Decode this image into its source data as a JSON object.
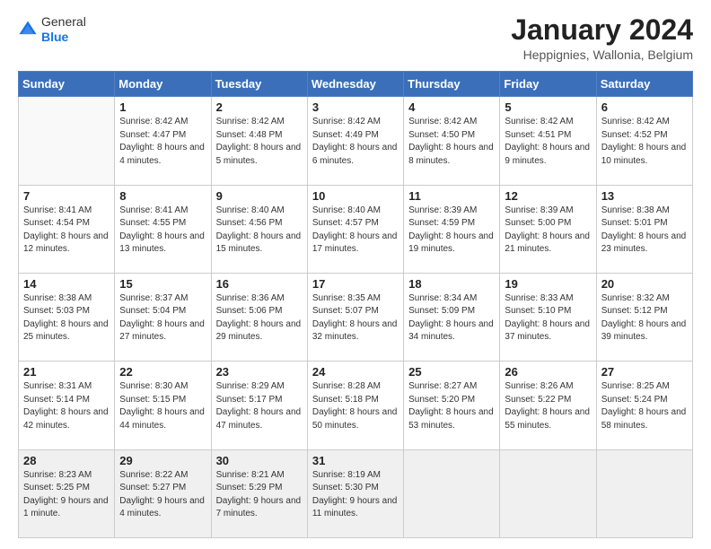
{
  "header": {
    "logo": {
      "line1": "General",
      "line2": "Blue"
    },
    "title": "January 2024",
    "subtitle": "Heppignies, Wallonia, Belgium"
  },
  "days_of_week": [
    "Sunday",
    "Monday",
    "Tuesday",
    "Wednesday",
    "Thursday",
    "Friday",
    "Saturday"
  ],
  "weeks": [
    [
      {
        "day": "",
        "sunrise": "",
        "sunset": "",
        "daylight": ""
      },
      {
        "day": "1",
        "sunrise": "Sunrise: 8:42 AM",
        "sunset": "Sunset: 4:47 PM",
        "daylight": "Daylight: 8 hours and 4 minutes."
      },
      {
        "day": "2",
        "sunrise": "Sunrise: 8:42 AM",
        "sunset": "Sunset: 4:48 PM",
        "daylight": "Daylight: 8 hours and 5 minutes."
      },
      {
        "day": "3",
        "sunrise": "Sunrise: 8:42 AM",
        "sunset": "Sunset: 4:49 PM",
        "daylight": "Daylight: 8 hours and 6 minutes."
      },
      {
        "day": "4",
        "sunrise": "Sunrise: 8:42 AM",
        "sunset": "Sunset: 4:50 PM",
        "daylight": "Daylight: 8 hours and 8 minutes."
      },
      {
        "day": "5",
        "sunrise": "Sunrise: 8:42 AM",
        "sunset": "Sunset: 4:51 PM",
        "daylight": "Daylight: 8 hours and 9 minutes."
      },
      {
        "day": "6",
        "sunrise": "Sunrise: 8:42 AM",
        "sunset": "Sunset: 4:52 PM",
        "daylight": "Daylight: 8 hours and 10 minutes."
      }
    ],
    [
      {
        "day": "7",
        "sunrise": "Sunrise: 8:41 AM",
        "sunset": "Sunset: 4:54 PM",
        "daylight": "Daylight: 8 hours and 12 minutes."
      },
      {
        "day": "8",
        "sunrise": "Sunrise: 8:41 AM",
        "sunset": "Sunset: 4:55 PM",
        "daylight": "Daylight: 8 hours and 13 minutes."
      },
      {
        "day": "9",
        "sunrise": "Sunrise: 8:40 AM",
        "sunset": "Sunset: 4:56 PM",
        "daylight": "Daylight: 8 hours and 15 minutes."
      },
      {
        "day": "10",
        "sunrise": "Sunrise: 8:40 AM",
        "sunset": "Sunset: 4:57 PM",
        "daylight": "Daylight: 8 hours and 17 minutes."
      },
      {
        "day": "11",
        "sunrise": "Sunrise: 8:39 AM",
        "sunset": "Sunset: 4:59 PM",
        "daylight": "Daylight: 8 hours and 19 minutes."
      },
      {
        "day": "12",
        "sunrise": "Sunrise: 8:39 AM",
        "sunset": "Sunset: 5:00 PM",
        "daylight": "Daylight: 8 hours and 21 minutes."
      },
      {
        "day": "13",
        "sunrise": "Sunrise: 8:38 AM",
        "sunset": "Sunset: 5:01 PM",
        "daylight": "Daylight: 8 hours and 23 minutes."
      }
    ],
    [
      {
        "day": "14",
        "sunrise": "Sunrise: 8:38 AM",
        "sunset": "Sunset: 5:03 PM",
        "daylight": "Daylight: 8 hours and 25 minutes."
      },
      {
        "day": "15",
        "sunrise": "Sunrise: 8:37 AM",
        "sunset": "Sunset: 5:04 PM",
        "daylight": "Daylight: 8 hours and 27 minutes."
      },
      {
        "day": "16",
        "sunrise": "Sunrise: 8:36 AM",
        "sunset": "Sunset: 5:06 PM",
        "daylight": "Daylight: 8 hours and 29 minutes."
      },
      {
        "day": "17",
        "sunrise": "Sunrise: 8:35 AM",
        "sunset": "Sunset: 5:07 PM",
        "daylight": "Daylight: 8 hours and 32 minutes."
      },
      {
        "day": "18",
        "sunrise": "Sunrise: 8:34 AM",
        "sunset": "Sunset: 5:09 PM",
        "daylight": "Daylight: 8 hours and 34 minutes."
      },
      {
        "day": "19",
        "sunrise": "Sunrise: 8:33 AM",
        "sunset": "Sunset: 5:10 PM",
        "daylight": "Daylight: 8 hours and 37 minutes."
      },
      {
        "day": "20",
        "sunrise": "Sunrise: 8:32 AM",
        "sunset": "Sunset: 5:12 PM",
        "daylight": "Daylight: 8 hours and 39 minutes."
      }
    ],
    [
      {
        "day": "21",
        "sunrise": "Sunrise: 8:31 AM",
        "sunset": "Sunset: 5:14 PM",
        "daylight": "Daylight: 8 hours and 42 minutes."
      },
      {
        "day": "22",
        "sunrise": "Sunrise: 8:30 AM",
        "sunset": "Sunset: 5:15 PM",
        "daylight": "Daylight: 8 hours and 44 minutes."
      },
      {
        "day": "23",
        "sunrise": "Sunrise: 8:29 AM",
        "sunset": "Sunset: 5:17 PM",
        "daylight": "Daylight: 8 hours and 47 minutes."
      },
      {
        "day": "24",
        "sunrise": "Sunrise: 8:28 AM",
        "sunset": "Sunset: 5:18 PM",
        "daylight": "Daylight: 8 hours and 50 minutes."
      },
      {
        "day": "25",
        "sunrise": "Sunrise: 8:27 AM",
        "sunset": "Sunset: 5:20 PM",
        "daylight": "Daylight: 8 hours and 53 minutes."
      },
      {
        "day": "26",
        "sunrise": "Sunrise: 8:26 AM",
        "sunset": "Sunset: 5:22 PM",
        "daylight": "Daylight: 8 hours and 55 minutes."
      },
      {
        "day": "27",
        "sunrise": "Sunrise: 8:25 AM",
        "sunset": "Sunset: 5:24 PM",
        "daylight": "Daylight: 8 hours and 58 minutes."
      }
    ],
    [
      {
        "day": "28",
        "sunrise": "Sunrise: 8:23 AM",
        "sunset": "Sunset: 5:25 PM",
        "daylight": "Daylight: 9 hours and 1 minute."
      },
      {
        "day": "29",
        "sunrise": "Sunrise: 8:22 AM",
        "sunset": "Sunset: 5:27 PM",
        "daylight": "Daylight: 9 hours and 4 minutes."
      },
      {
        "day": "30",
        "sunrise": "Sunrise: 8:21 AM",
        "sunset": "Sunset: 5:29 PM",
        "daylight": "Daylight: 9 hours and 7 minutes."
      },
      {
        "day": "31",
        "sunrise": "Sunrise: 8:19 AM",
        "sunset": "Sunset: 5:30 PM",
        "daylight": "Daylight: 9 hours and 11 minutes."
      },
      {
        "day": "",
        "sunrise": "",
        "sunset": "",
        "daylight": ""
      },
      {
        "day": "",
        "sunrise": "",
        "sunset": "",
        "daylight": ""
      },
      {
        "day": "",
        "sunrise": "",
        "sunset": "",
        "daylight": ""
      }
    ]
  ]
}
